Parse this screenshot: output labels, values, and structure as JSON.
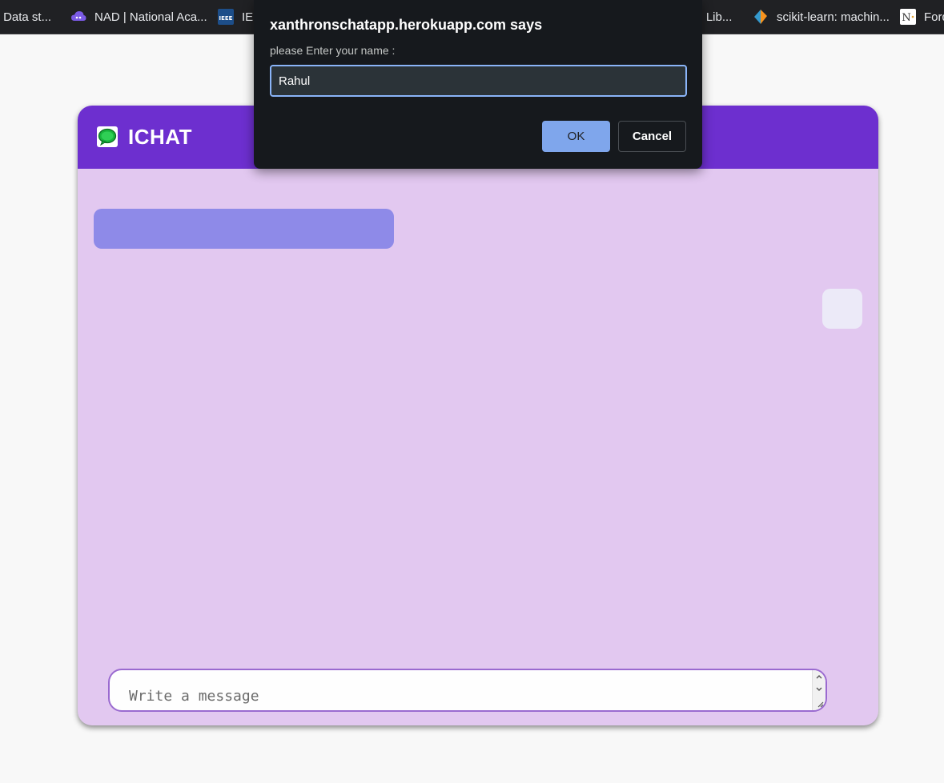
{
  "bookmarks": [
    {
      "label": "| Data st...",
      "icon": "chart-icon"
    },
    {
      "label": "NAD | National Aca...",
      "icon": "cloud-icon"
    },
    {
      "label": "IE",
      "icon": "ieee-icon"
    },
    {
      "label": "al Lib...",
      "icon": "library-icon"
    },
    {
      "label": "scikit-learn: machin...",
      "icon": "scikit-learn-icon"
    },
    {
      "label": "Ford",
      "icon": "n-logo-icon"
    }
  ],
  "dialog": {
    "title": "xanthronschatapp.herokuapp.com says",
    "message": "please Enter your name :",
    "input_value": "Rahul",
    "ok_label": "OK",
    "cancel_label": "Cancel"
  },
  "chat": {
    "title": "ICHAT",
    "logo_icon": "chat-bubble-icon",
    "message_placeholder": "Write a message"
  },
  "colors": {
    "header": "#6d2fcf",
    "background": "#e2c8f0",
    "bubble_left": "#8e8ae8",
    "bubble_right": "#eceaf8",
    "ok_button": "#7fa6ec"
  }
}
